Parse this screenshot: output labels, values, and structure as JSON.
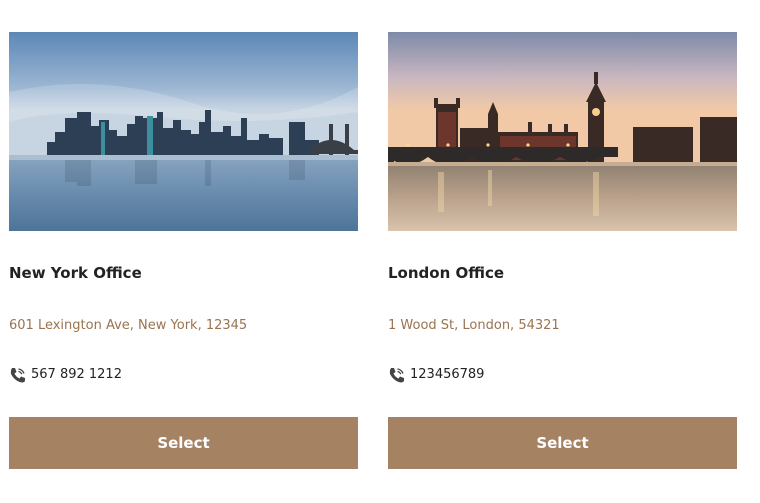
{
  "offices": [
    {
      "title": "New York Office",
      "address": "601 Lexington Ave, New York, 12345",
      "phone": "567 892 1212",
      "button_label": "Select",
      "icon": "phone-icon"
    },
    {
      "title": "London Office",
      "address": "1 Wood St, London, 54321",
      "phone": "123456789",
      "button_label": "Select",
      "icon": "phone-icon"
    }
  ],
  "colors": {
    "accent": "#a58262",
    "address_text": "#9a7450",
    "title_text": "#222222"
  }
}
